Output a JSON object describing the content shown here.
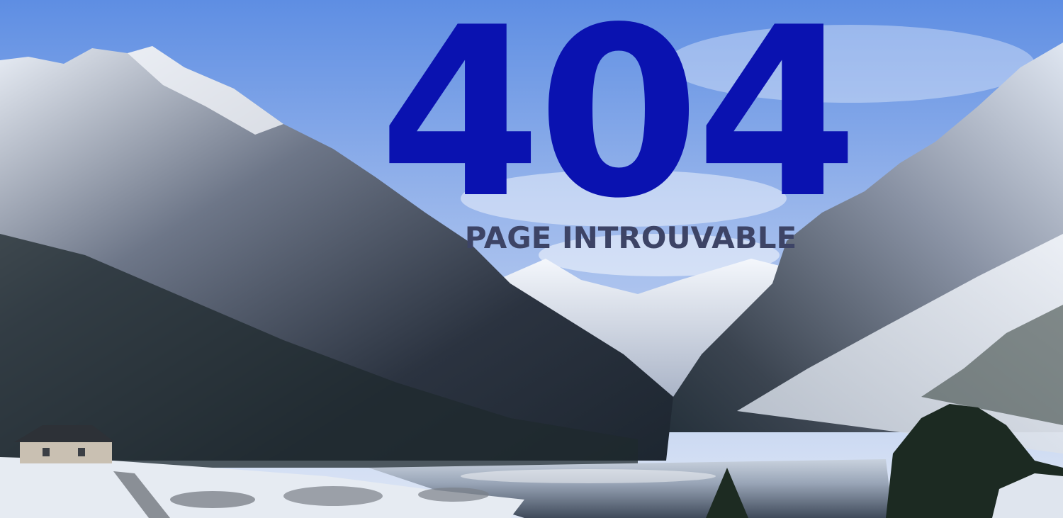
{
  "error": {
    "code": "404",
    "message": "PAGE INTROUVABLE"
  },
  "colors": {
    "code": "#0a12b0",
    "message": "#3d4466",
    "sky": "#8fb0e8",
    "lake": "#9aa6b8"
  },
  "background": {
    "icon": "mountain-lake-photo"
  }
}
